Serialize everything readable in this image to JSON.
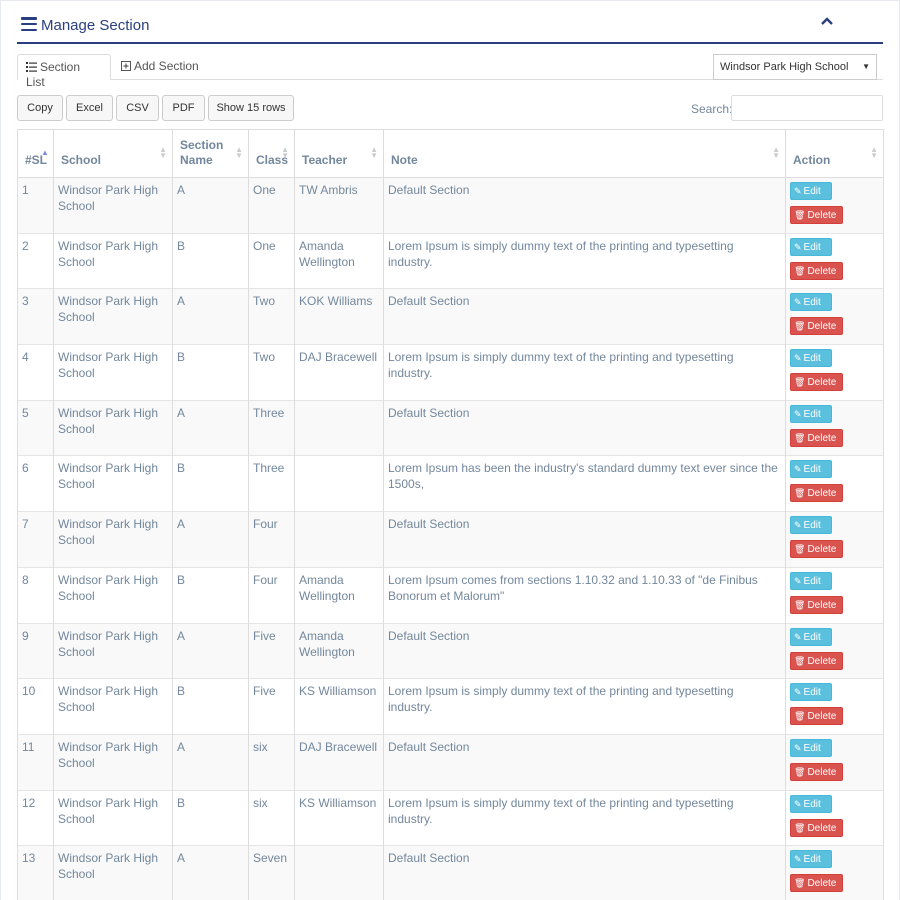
{
  "header": {
    "title": "Manage Section"
  },
  "tabs": [
    {
      "label": "Section List"
    },
    {
      "label": "Add Section"
    }
  ],
  "school_select": {
    "value": "Windsor Park High School"
  },
  "toolbar": {
    "copy": "Copy",
    "excel": "Excel",
    "csv": "CSV",
    "pdf": "PDF",
    "show_rows": "Show 15 rows"
  },
  "search": {
    "label": "Search:",
    "value": ""
  },
  "table": {
    "headers": {
      "sl": "#SL",
      "school": "School",
      "section_name": "Section Name",
      "class": "Class",
      "teacher": "Teacher",
      "note": "Note",
      "action": "Action"
    },
    "actions": {
      "edit": "Edit",
      "delete": "Delete"
    },
    "rows": [
      {
        "sl": "1",
        "school": "Windsor Park High School",
        "section": "A",
        "class": "One",
        "teacher": "TW Ambris",
        "note": "Default Section"
      },
      {
        "sl": "2",
        "school": "Windsor Park High School",
        "section": "B",
        "class": "One",
        "teacher": "Amanda Wellington",
        "note": "Lorem Ipsum is simply dummy text of the printing and typesetting industry."
      },
      {
        "sl": "3",
        "school": "Windsor Park High School",
        "section": "A",
        "class": "Two",
        "teacher": "KOK Williams",
        "note": "Default Section"
      },
      {
        "sl": "4",
        "school": "Windsor Park High School",
        "section": "B",
        "class": "Two",
        "teacher": "DAJ Bracewell",
        "note": "Lorem Ipsum is simply dummy text of the printing and typesetting industry."
      },
      {
        "sl": "5",
        "school": "Windsor Park High School",
        "section": "A",
        "class": "Three",
        "teacher": "",
        "note": "Default Section"
      },
      {
        "sl": "6",
        "school": "Windsor Park High School",
        "section": "B",
        "class": "Three",
        "teacher": "",
        "note": "Lorem Ipsum has been the industry's standard dummy text ever since the 1500s,"
      },
      {
        "sl": "7",
        "school": "Windsor Park High School",
        "section": "A",
        "class": "Four",
        "teacher": "",
        "note": "Default Section"
      },
      {
        "sl": "8",
        "school": "Windsor Park High School",
        "section": "B",
        "class": "Four",
        "teacher": "Amanda Wellington",
        "note": "Lorem Ipsum comes from sections 1.10.32 and 1.10.33 of \"de Finibus Bonorum et Malorum\""
      },
      {
        "sl": "9",
        "school": "Windsor Park High School",
        "section": "A",
        "class": "Five",
        "teacher": "Amanda Wellington",
        "note": "Default Section"
      },
      {
        "sl": "10",
        "school": "Windsor Park High School",
        "section": "B",
        "class": "Five",
        "teacher": "KS Williamson",
        "note": "Lorem Ipsum is simply dummy text of the printing and typesetting industry."
      },
      {
        "sl": "11",
        "school": "Windsor Park High School",
        "section": "A",
        "class": "six",
        "teacher": "DAJ Bracewell",
        "note": "Default Section"
      },
      {
        "sl": "12",
        "school": "Windsor Park High School",
        "section": "B",
        "class": "six",
        "teacher": "KS Williamson",
        "note": "Lorem Ipsum is simply dummy text of the printing and typesetting industry."
      },
      {
        "sl": "13",
        "school": "Windsor Park High School",
        "section": "A",
        "class": "Seven",
        "teacher": "",
        "note": "Default Section"
      }
    ]
  },
  "colors": {
    "primary": "#2a3f7f",
    "text": "#73879c",
    "edit": "#5bc0de",
    "delete": "#d9534f"
  }
}
